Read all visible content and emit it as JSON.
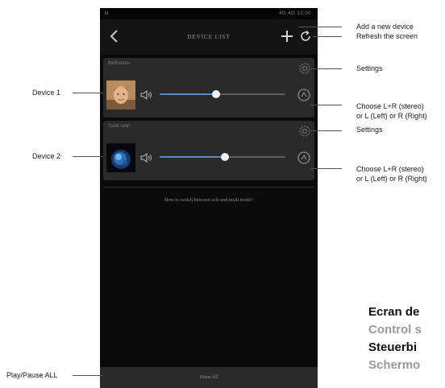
{
  "status_bar": {
    "left_indicator": "◘",
    "right_info": "4G 4G 12:00"
  },
  "header": {
    "title": "DEVICE LIST"
  },
  "devices": [
    {
      "name": "Bellissimo",
      "volume": 0.45,
      "thumbnail": "person-face-photo"
    },
    {
      "name": "Saint renn",
      "volume": 0.52,
      "thumbnail": "blue-abstract-photo"
    }
  ],
  "help_link": "How to switch between solo and multi mode?",
  "footer": {
    "pause_all": "Pause All"
  },
  "annotations": {
    "add_device": "Add a new device",
    "refresh": "Refresh the screen",
    "settings_1": "Settings",
    "device_1": "Device 1",
    "channel_1_line1": "Choose L+R (stereo)",
    "channel_1_line2": "or L (Left) or R (Right)",
    "settings_2": "Settings",
    "device_2": "Device 2",
    "channel_2_line1": "Choose L+R (stereo)",
    "channel_2_line2": "or L (Left) or R (Right)",
    "play_pause_all": "Play/Pause ALL"
  },
  "multilingual_title": [
    {
      "text": "Ecran de",
      "color": "#111111"
    },
    {
      "text": "Control s",
      "color": "#9a9a9a"
    },
    {
      "text": "Steuerbi",
      "color": "#111111"
    },
    {
      "text": "Schermo",
      "color": "#9a9a9a"
    }
  ],
  "colors": {
    "app_background": "#0b0b0b",
    "card_background": "#2a2a2a",
    "slider_accent": "#4f8ec9",
    "annotation_line": "#555555"
  },
  "icons": {
    "back": "chevron-left-icon",
    "add": "plus-icon",
    "refresh": "refresh-icon",
    "settings": "gear-icon",
    "volume": "speaker-icon",
    "channel": "channel-select-icon"
  }
}
